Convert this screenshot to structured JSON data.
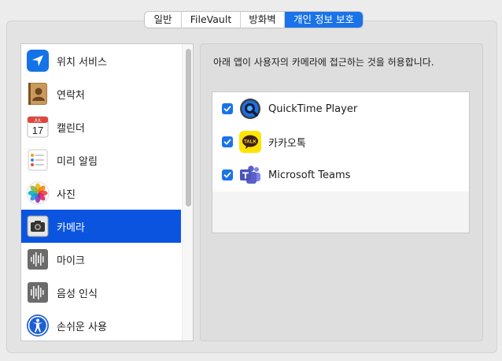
{
  "tabs": [
    {
      "label": "일반",
      "active": false
    },
    {
      "label": "FileVault",
      "active": false
    },
    {
      "label": "방화벽",
      "active": false
    },
    {
      "label": "개인 정보 보호",
      "active": true
    }
  ],
  "sidebar": {
    "selected_index": 5,
    "items": [
      {
        "label": "위치 서비스",
        "icon": "location-arrow-icon"
      },
      {
        "label": "연락처",
        "icon": "contacts-book-icon"
      },
      {
        "label": "캘린더",
        "icon": "calendar-icon",
        "icon_text": {
          "month": "JUL",
          "day": "17"
        }
      },
      {
        "label": "미리 알림",
        "icon": "reminders-icon"
      },
      {
        "label": "사진",
        "icon": "photos-icon"
      },
      {
        "label": "카메라",
        "icon": "camera-icon"
      },
      {
        "label": "마이크",
        "icon": "microphone-waveform-icon"
      },
      {
        "label": "음성 인식",
        "icon": "speech-recognition-waveform-icon"
      },
      {
        "label": "손쉬운 사용",
        "icon": "accessibility-icon"
      }
    ]
  },
  "panel": {
    "description": "아래 앱이 사용자의 카메라에 접근하는 것을 허용합니다.",
    "apps": [
      {
        "name": "QuickTime Player",
        "checked": true,
        "icon": "quicktime-icon"
      },
      {
        "name": "카카오톡",
        "checked": true,
        "icon": "kakaotalk-icon",
        "icon_text": "TALK"
      },
      {
        "name": "Microsoft Teams",
        "checked": true,
        "icon": "teams-icon"
      }
    ]
  },
  "colors": {
    "accent": "#1a73e8",
    "selection": "#0a54e0",
    "kakao_yellow": "#fee500",
    "teams_purple": "#5b5fc7"
  }
}
